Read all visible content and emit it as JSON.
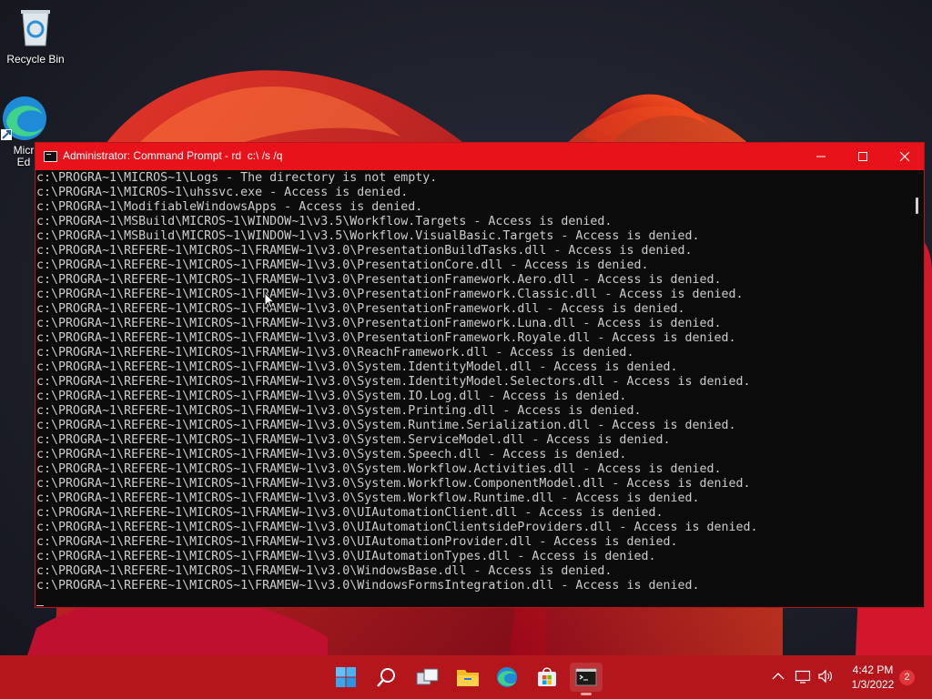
{
  "desktop": {
    "icons": [
      {
        "label": "Recycle Bin"
      },
      {
        "label": "Micr\nEd"
      }
    ]
  },
  "window": {
    "title": "Administrator: Command Prompt - rd  c:\\ /s /q",
    "console_lines": [
      "c:\\PROGRA~1\\MICROS~1\\Logs - The directory is not empty.",
      "c:\\PROGRA~1\\MICROS~1\\uhssvc.exe - Access is denied.",
      "c:\\PROGRA~1\\ModifiableWindowsApps - Access is denied.",
      "c:\\PROGRA~1\\MSBuild\\MICROS~1\\WINDOW~1\\v3.5\\Workflow.Targets - Access is denied.",
      "c:\\PROGRA~1\\MSBuild\\MICROS~1\\WINDOW~1\\v3.5\\Workflow.VisualBasic.Targets - Access is denied.",
      "c:\\PROGRA~1\\REFERE~1\\MICROS~1\\FRAMEW~1\\v3.0\\PresentationBuildTasks.dll - Access is denied.",
      "c:\\PROGRA~1\\REFERE~1\\MICROS~1\\FRAMEW~1\\v3.0\\PresentationCore.dll - Access is denied.",
      "c:\\PROGRA~1\\REFERE~1\\MICROS~1\\FRAMEW~1\\v3.0\\PresentationFramework.Aero.dll - Access is denied.",
      "c:\\PROGRA~1\\REFERE~1\\MICROS~1\\FRAMEW~1\\v3.0\\PresentationFramework.Classic.dll - Access is denied.",
      "c:\\PROGRA~1\\REFERE~1\\MICROS~1\\FRAMEW~1\\v3.0\\PresentationFramework.dll - Access is denied.",
      "c:\\PROGRA~1\\REFERE~1\\MICROS~1\\FRAMEW~1\\v3.0\\PresentationFramework.Luna.dll - Access is denied.",
      "c:\\PROGRA~1\\REFERE~1\\MICROS~1\\FRAMEW~1\\v3.0\\PresentationFramework.Royale.dll - Access is denied.",
      "c:\\PROGRA~1\\REFERE~1\\MICROS~1\\FRAMEW~1\\v3.0\\ReachFramework.dll - Access is denied.",
      "c:\\PROGRA~1\\REFERE~1\\MICROS~1\\FRAMEW~1\\v3.0\\System.IdentityModel.dll - Access is denied.",
      "c:\\PROGRA~1\\REFERE~1\\MICROS~1\\FRAMEW~1\\v3.0\\System.IdentityModel.Selectors.dll - Access is denied.",
      "c:\\PROGRA~1\\REFERE~1\\MICROS~1\\FRAMEW~1\\v3.0\\System.IO.Log.dll - Access is denied.",
      "c:\\PROGRA~1\\REFERE~1\\MICROS~1\\FRAMEW~1\\v3.0\\System.Printing.dll - Access is denied.",
      "c:\\PROGRA~1\\REFERE~1\\MICROS~1\\FRAMEW~1\\v3.0\\System.Runtime.Serialization.dll - Access is denied.",
      "c:\\PROGRA~1\\REFERE~1\\MICROS~1\\FRAMEW~1\\v3.0\\System.ServiceModel.dll - Access is denied.",
      "c:\\PROGRA~1\\REFERE~1\\MICROS~1\\FRAMEW~1\\v3.0\\System.Speech.dll - Access is denied.",
      "c:\\PROGRA~1\\REFERE~1\\MICROS~1\\FRAMEW~1\\v3.0\\System.Workflow.Activities.dll - Access is denied.",
      "c:\\PROGRA~1\\REFERE~1\\MICROS~1\\FRAMEW~1\\v3.0\\System.Workflow.ComponentModel.dll - Access is denied.",
      "c:\\PROGRA~1\\REFERE~1\\MICROS~1\\FRAMEW~1\\v3.0\\System.Workflow.Runtime.dll - Access is denied.",
      "c:\\PROGRA~1\\REFERE~1\\MICROS~1\\FRAMEW~1\\v3.0\\UIAutomationClient.dll - Access is denied.",
      "c:\\PROGRA~1\\REFERE~1\\MICROS~1\\FRAMEW~1\\v3.0\\UIAutomationClientsideProviders.dll - Access is denied.",
      "c:\\PROGRA~1\\REFERE~1\\MICROS~1\\FRAMEW~1\\v3.0\\UIAutomationProvider.dll - Access is denied.",
      "c:\\PROGRA~1\\REFERE~1\\MICROS~1\\FRAMEW~1\\v3.0\\UIAutomationTypes.dll - Access is denied.",
      "c:\\PROGRA~1\\REFERE~1\\MICROS~1\\FRAMEW~1\\v3.0\\WindowsBase.dll - Access is denied.",
      "c:\\PROGRA~1\\REFERE~1\\MICROS~1\\FRAMEW~1\\v3.0\\WindowsFormsIntegration.dll - Access is denied."
    ],
    "colors": {
      "titlebar": "#e8121a",
      "console_bg": "#0c0c0c",
      "console_text": "#cccccc"
    }
  },
  "taskbar": {
    "items": [
      "start-icon",
      "search-icon",
      "task-view-icon",
      "file-explorer-icon",
      "edge-icon",
      "store-icon",
      "terminal-icon"
    ],
    "tray_icons": [
      "chevron-up-icon",
      "network-icon",
      "volume-icon"
    ],
    "clock": {
      "time": "4:42 PM",
      "date": "1/3/2022"
    },
    "notification_count": "2",
    "colors": {
      "taskbar": "#b4161c"
    }
  }
}
